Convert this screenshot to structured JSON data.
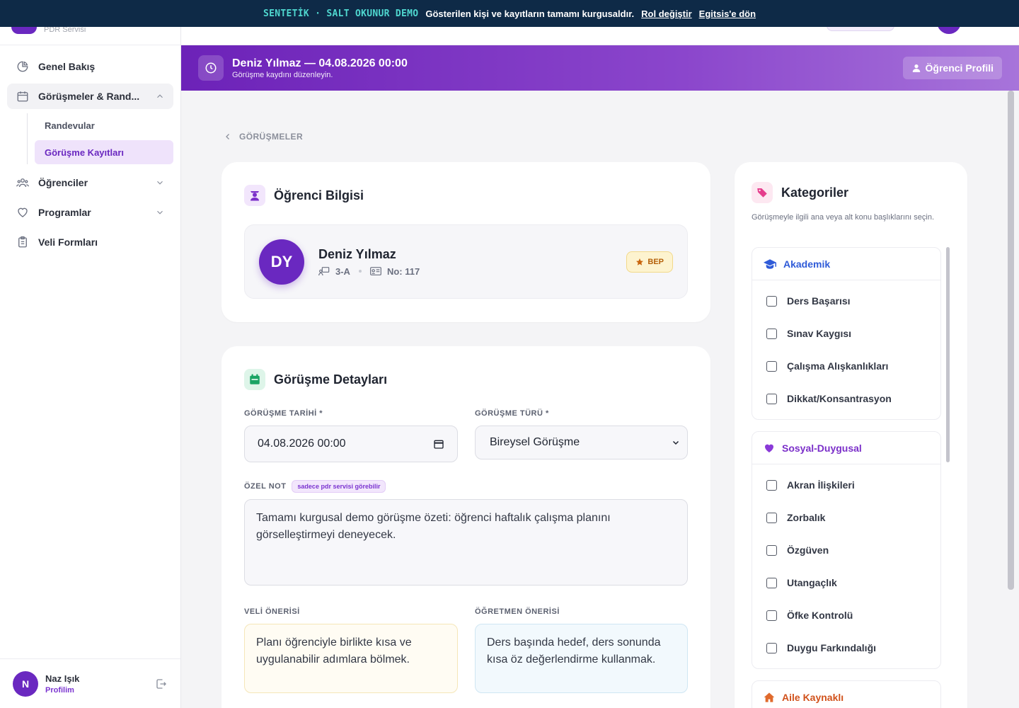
{
  "banner": {
    "tag": "SENTETİK · SALT OKUNUR DEMO",
    "text": "Gösterilen kişi ve kayıtların tamamı kurgusaldır.",
    "role_link": "Rol değiştir",
    "back_link": "Egitsis'e dön"
  },
  "brand": {
    "subtitle": "PDR Servisi"
  },
  "sidebar": {
    "items": [
      {
        "label": "Genel Bakış",
        "icon": "pie-chart-icon"
      },
      {
        "label": "Görüşmeler & Rand...",
        "icon": "calendar-icon"
      },
      {
        "label": "Öğrenciler",
        "icon": "users-icon"
      },
      {
        "label": "Programlar",
        "icon": "heart-icon"
      },
      {
        "label": "Veli Formları",
        "icon": "clipboard-icon"
      }
    ],
    "subitems": [
      {
        "label": "Randevular"
      },
      {
        "label": "Görüşme Kayıtları"
      }
    ]
  },
  "user": {
    "initial": "N",
    "name": "Naz Işık",
    "link": "Profilim"
  },
  "header": {
    "title": "Deniz Yılmaz — 04.08.2026 00:00",
    "subtitle": "Görüşme kaydını düzenleyin.",
    "profile_button": "Öğrenci Profili"
  },
  "breadcrumb": {
    "label": "GÖRÜŞMELER"
  },
  "student_card": {
    "title": "Öğrenci Bilgisi",
    "initials": "DY",
    "name": "Deniz Yılmaz",
    "class": "3-A",
    "number": "No: 117",
    "badge": "BEP"
  },
  "details": {
    "title": "Görüşme Detayları",
    "date_label": "GÖRÜŞME TARİHİ *",
    "date_value": "04.08.2026 00:00",
    "type_label": "GÖRÜŞME TÜRÜ *",
    "type_value": "Bireysel Görüşme",
    "note_label": "ÖZEL NOT",
    "note_pill": "sadece pdr servisi görebilir",
    "note_value": "Tamamı kurgusal demo görüşme özeti: öğrenci haftalık çalışma planını görselleştirmeyi deneyecek.",
    "parent_label": "VELİ ÖNERİSİ",
    "parent_value": "Planı öğrenciyle birlikte kısa ve uygulanabilir adımlara bölmek.",
    "teacher_label": "ÖĞRETMEN ÖNERİSİ",
    "teacher_value": "Ders başında hedef, ders sonunda kısa öz değerlendirme kullanmak."
  },
  "categories": {
    "title": "Kategoriler",
    "description": "Görüşmeyle ilgili ana veya alt konu başlıklarını seçin.",
    "groups": [
      {
        "name": "Akademik",
        "color": "#2f5bd8",
        "icon": "graduation-cap-icon",
        "options": [
          "Ders Başarısı",
          "Sınav Kaygısı",
          "Çalışma Alışkanlıkları",
          "Dikkat/Konsantrasyon"
        ]
      },
      {
        "name": "Sosyal-Duygusal",
        "color": "#7b2fc9",
        "icon": "heart-icon",
        "options": [
          "Akran İlişkileri",
          "Zorbalık",
          "Özgüven",
          "Utangaçlık",
          "Öfke Kontrolü",
          "Duygu Farkındalığı"
        ]
      },
      {
        "name": "Aile Kaynaklı",
        "color": "#d1521c",
        "icon": "home-icon",
        "options": []
      }
    ]
  },
  "colors": {
    "primary": "#6a28c0",
    "banner": "#0e2a47",
    "banner_tag": "#4fd7cf"
  }
}
